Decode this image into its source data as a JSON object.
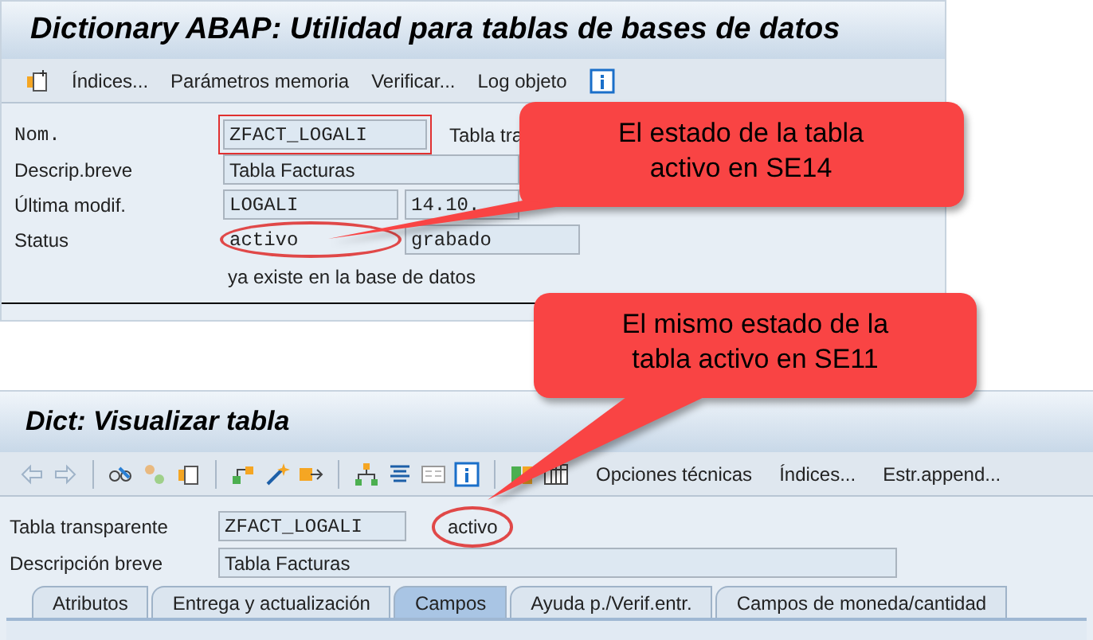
{
  "se14": {
    "title": "Dictionary ABAP: Utilidad para tablas de bases de datos",
    "toolbar": [
      "Índices...",
      "Parámetros memoria",
      "Verificar...",
      "Log objeto"
    ],
    "rows": [
      {
        "label": "Nom.",
        "fields": [
          {
            "value": "ZFACT_LOGALI",
            "focused": true
          },
          {
            "value": "Tabla tra",
            "kind": "text"
          }
        ]
      },
      {
        "label": "Descrip.breve",
        "fields": [
          {
            "value": "Tabla Facturas",
            "focused": false
          }
        ]
      },
      {
        "label": "Última modif.",
        "fields": [
          {
            "value": "LOGALI",
            "focused": false
          },
          {
            "value": "14.10.",
            "focused": false
          }
        ]
      },
      {
        "label": "Status",
        "fields": [
          {
            "value": "activo",
            "focused": false,
            "circled": true
          },
          {
            "value": "grabado",
            "focused": false
          }
        ]
      }
    ],
    "note": "ya existe en la base de datos"
  },
  "se11": {
    "title": "Dict: Visualizar tabla",
    "toolbar": [
      "Opciones técnicas",
      "Índices...",
      "Estr.append..."
    ],
    "rows": [
      {
        "label": "Tabla transparente",
        "value": "ZFACT_LOGALI",
        "status": "activo"
      },
      {
        "label": "Descripción breve",
        "value": "Tabla Facturas"
      }
    ],
    "tabs": [
      {
        "label": "Atributos",
        "selected": false
      },
      {
        "label": "Entrega y actualización",
        "selected": false
      },
      {
        "label": "Campos",
        "selected": true
      },
      {
        "label": "Ayuda p./Verif.entr.",
        "selected": false
      },
      {
        "label": "Campos de moneda/cantidad",
        "selected": false
      }
    ]
  },
  "callouts": [
    {
      "text": "El estado de la tabla activo en SE14"
    },
    {
      "text": "El mismo estado de la tabla activo en SE11"
    }
  ]
}
